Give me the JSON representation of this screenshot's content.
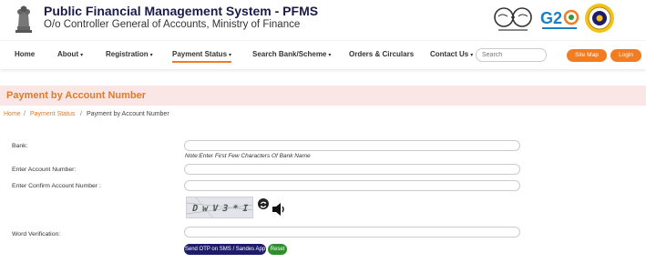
{
  "header": {
    "title": "Public Financial Management System - PFMS",
    "subtitle": "O/o Controller General of Accounts, Ministry of Finance"
  },
  "nav": {
    "items": [
      {
        "label": "Home",
        "caret": ""
      },
      {
        "label": "About",
        "caret": "▾"
      },
      {
        "label": "Registration",
        "caret": "▾"
      },
      {
        "label": "Payment Status",
        "caret": "▾"
      },
      {
        "label": "Search Bank/Scheme",
        "caret": "▾"
      },
      {
        "label": "Orders & Circulars",
        "caret": ""
      },
      {
        "label": "Contact Us",
        "caret": "▾"
      }
    ],
    "active_item": "Payment Status",
    "search_placeholder": "Search",
    "site_map_label": "Site Map",
    "login_label": "Login"
  },
  "page": {
    "title": "Payment by Account Number"
  },
  "breadcrumb": {
    "items": [
      "Home",
      "Payment Status",
      "Payment by Account Number"
    ],
    "separator": "/"
  },
  "form": {
    "bank_label": "Bank:",
    "bank_note": "Note:Enter First Few Characters Of Bank Name",
    "account_label": "Enter Account Number:",
    "confirm_account_label": "Enter Confirm Account Number :",
    "captcha_text": "DwV3*I",
    "word_verification_label": "Word Verification:",
    "send_otp_label": "Send OTP on SMS / Sandes App",
    "reset_label": "Reset"
  },
  "colors": {
    "accent": "#f47c20",
    "title_navy": "#1b1b4a",
    "banner_bg": "#fbe6e6",
    "otp_button": "#1f1b6b",
    "reset_button": "#2f8f2f"
  }
}
